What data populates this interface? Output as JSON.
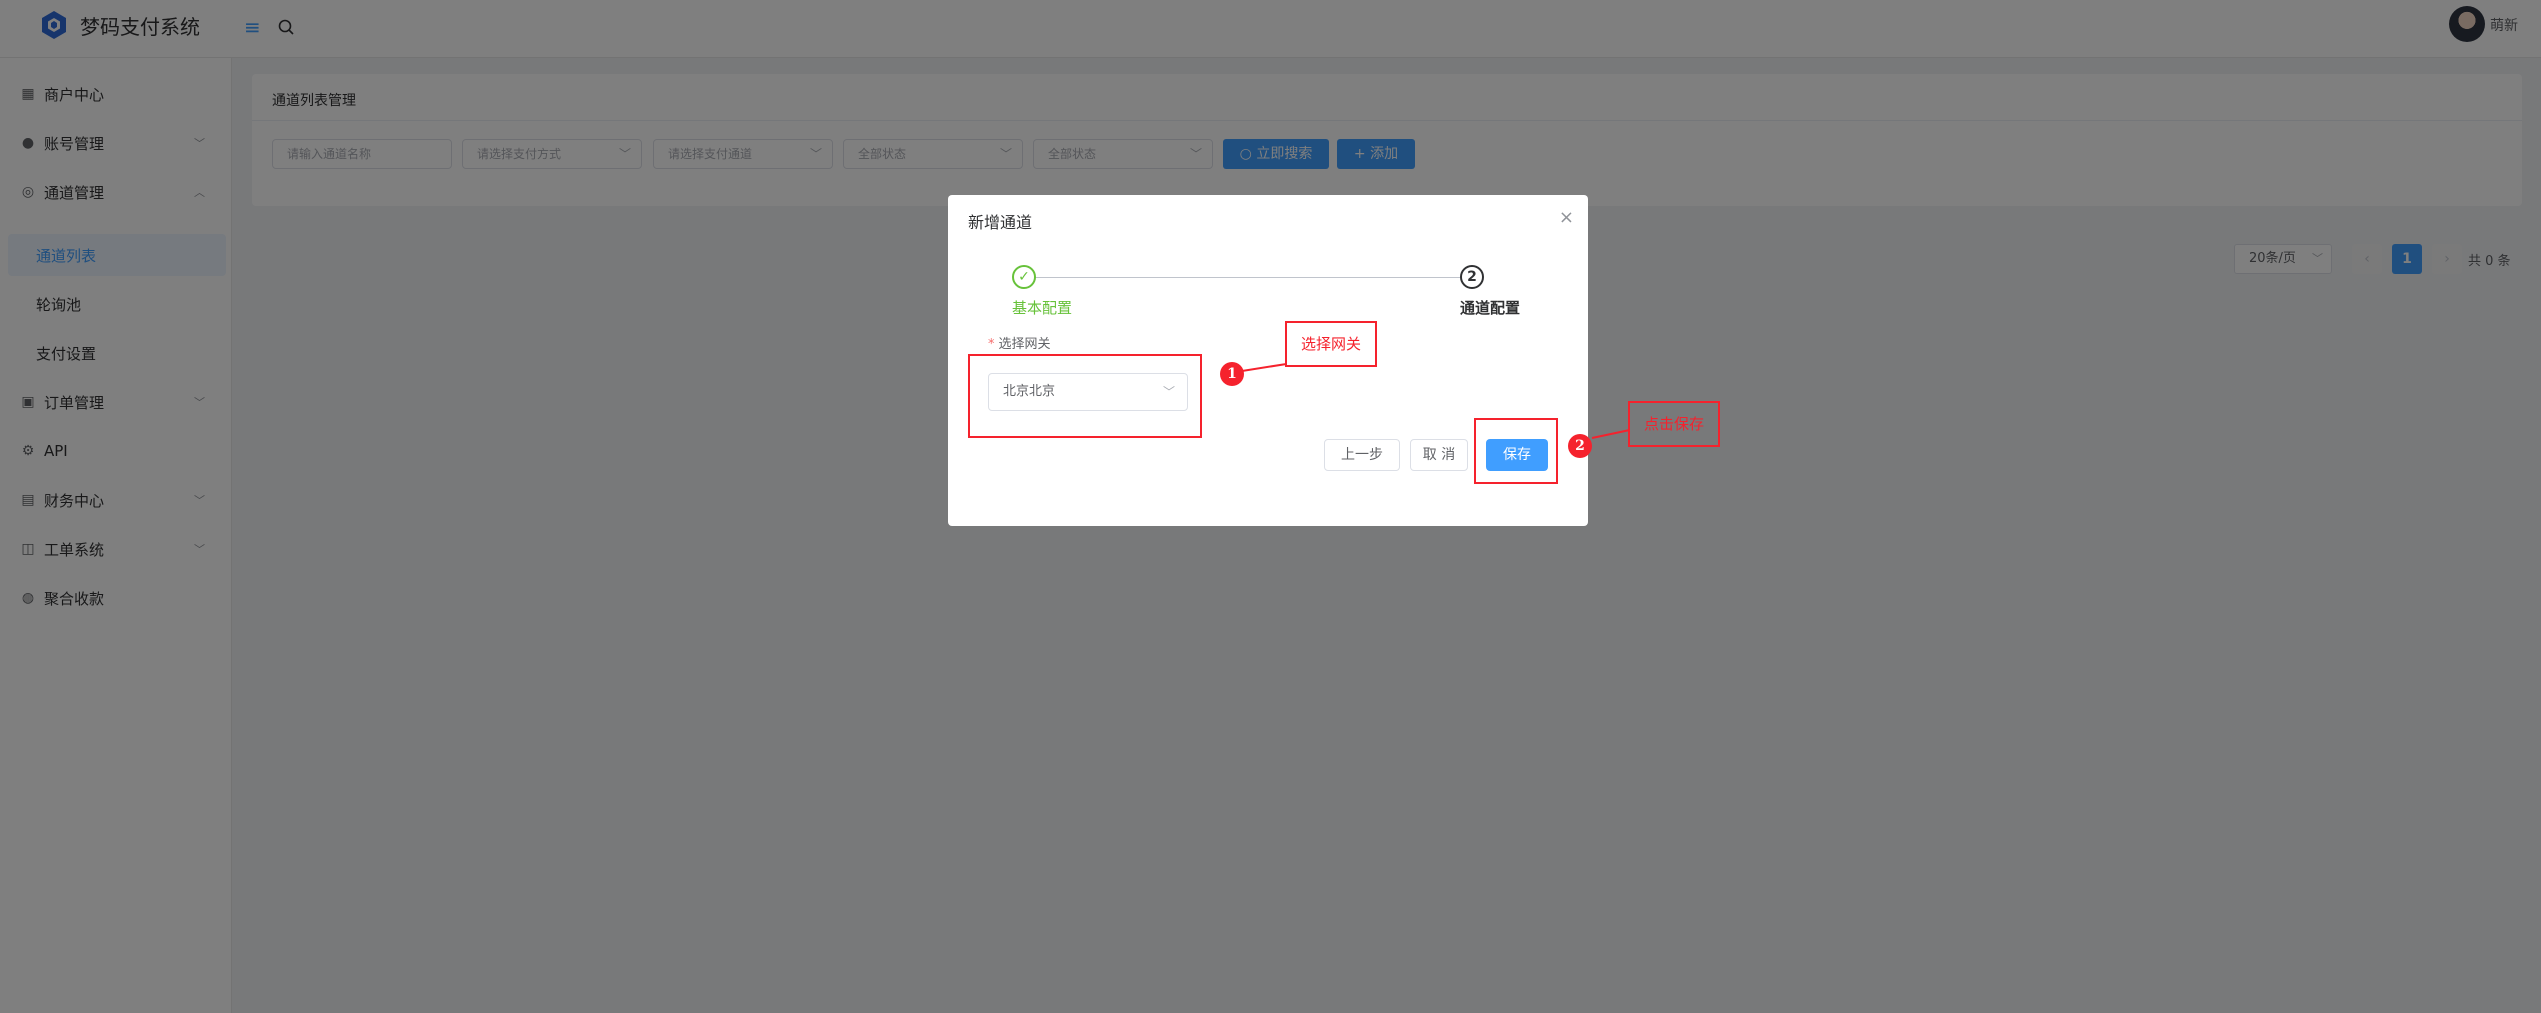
{
  "app": {
    "title": "梦码支付系统"
  },
  "header": {
    "username": "萌新"
  },
  "sidebar": {
    "items": [
      {
        "label": "商户中心"
      },
      {
        "label": "账号管理"
      },
      {
        "label": "通道管理"
      },
      {
        "label": "通道列表"
      },
      {
        "label": "轮询池"
      },
      {
        "label": "支付设置"
      },
      {
        "label": "订单管理"
      },
      {
        "label": "API"
      },
      {
        "label": "财务中心"
      },
      {
        "label": "工单系统"
      },
      {
        "label": "聚合收款"
      }
    ]
  },
  "card": {
    "title": "通道列表管理",
    "filters": {
      "name_placeholder": "请输入通道名称",
      "pay_method": "请选择支付方式",
      "pay_channel": "请选择支付通道",
      "status1": "全部状态",
      "status2": "全部状态"
    },
    "search_btn": "立即搜索",
    "add_btn": "添加"
  },
  "pagination": {
    "page_size": "20条/页",
    "current": "1",
    "total": "共 0 条"
  },
  "dialog": {
    "title": "新增通道",
    "steps": [
      {
        "label": "基本配置",
        "status": "done"
      },
      {
        "label": "通道配置",
        "number": "2"
      }
    ],
    "gateway_label": "选择网关",
    "gateway_value": "北京北京",
    "prev_btn": "上一步",
    "cancel_btn": "取 消",
    "save_btn": "保存"
  },
  "annotations": {
    "n1": "1",
    "callout1": "选择网关",
    "n2": "2",
    "callout2": "点击保存"
  },
  "colors": {
    "primary": "#409eff",
    "success": "#67c23a",
    "annotation": "#f5222d"
  }
}
